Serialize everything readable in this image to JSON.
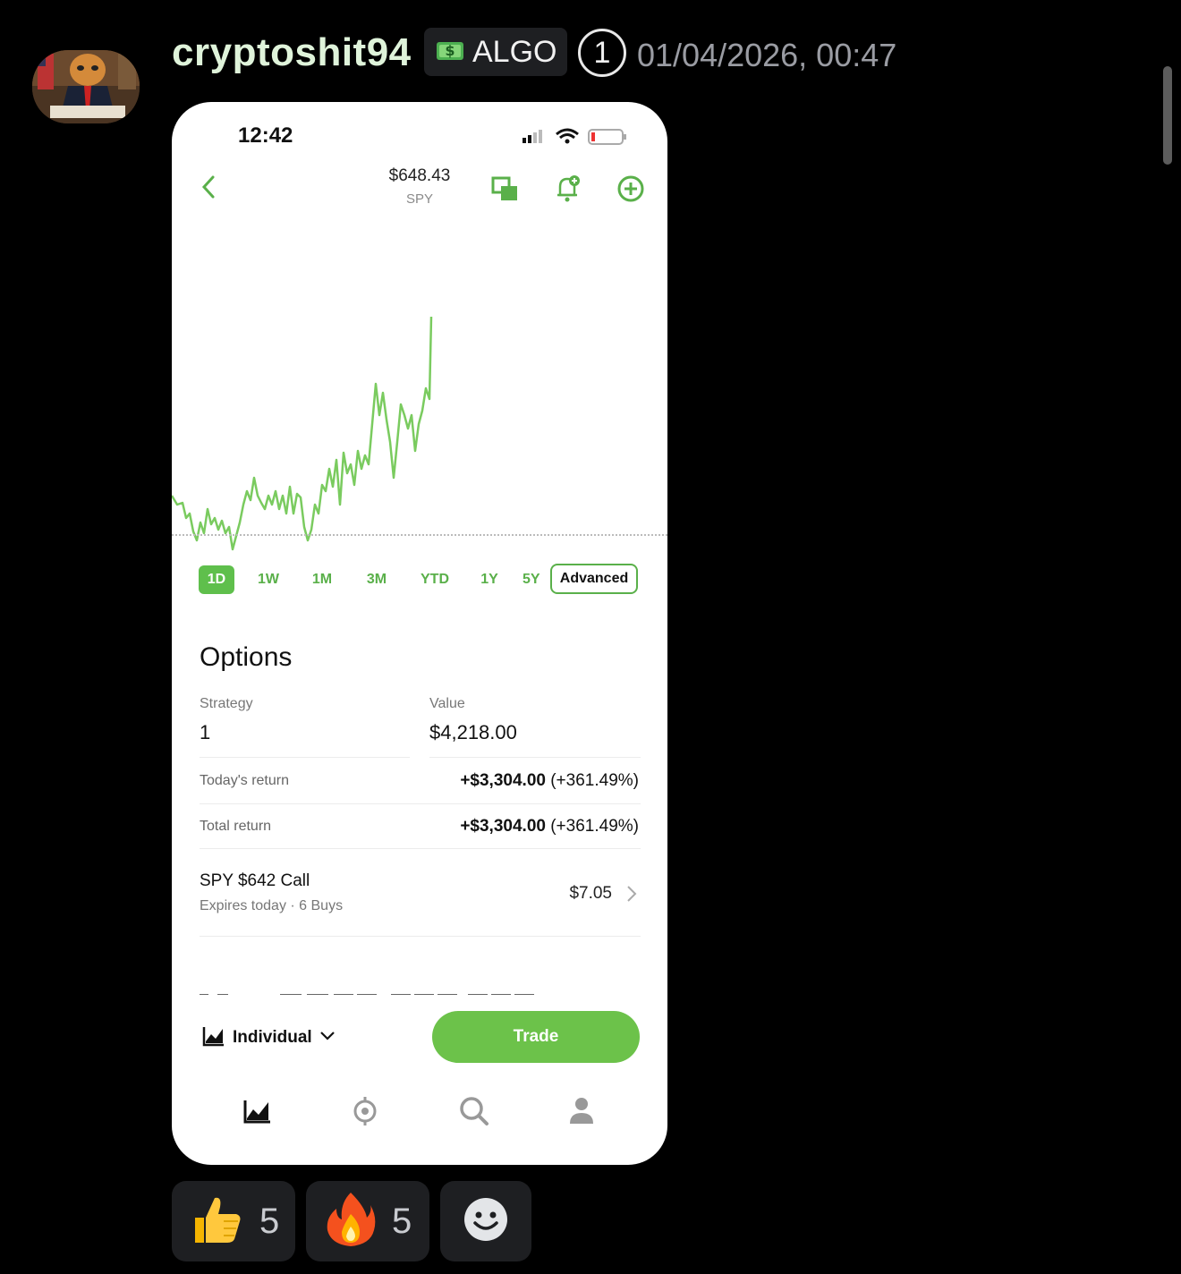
{
  "message": {
    "username": "cryptoshit94",
    "tag": {
      "icon": "money-icon",
      "label": "ALGO"
    },
    "badge": "1",
    "timestamp": "01/04/2026, 00:47"
  },
  "phone": {
    "status_time": "12:42",
    "header": {
      "price": "$648.43",
      "symbol": "SPY"
    },
    "ranges": [
      "1D",
      "1W",
      "1M",
      "3M",
      "YTD",
      "1Y",
      "5Y"
    ],
    "active_range": "1D",
    "advanced_label": "Advanced",
    "options": {
      "title": "Options",
      "strategy_label": "Strategy",
      "strategy_value": "1",
      "value_label": "Value",
      "value_value": "$4,218.00",
      "todays_return_label": "Today's return",
      "todays_return_amount": "+$3,304.00",
      "todays_return_pct": "(+361.49%)",
      "total_return_label": "Total return",
      "total_return_amount": "+$3,304.00",
      "total_return_pct": "(+361.49%)",
      "contract_title": "SPY $642 Call",
      "contract_sub": "Expires today · 6 Buys",
      "contract_price": "$7.05"
    },
    "account_label": "Individual",
    "trade_label": "Trade",
    "accent": "#6cc24a"
  },
  "reactions": [
    {
      "emoji": "thumbs-up-icon",
      "count": "5"
    },
    {
      "emoji": "fire-icon",
      "count": "5"
    },
    {
      "emoji": "add-reaction-icon",
      "count": ""
    }
  ]
}
